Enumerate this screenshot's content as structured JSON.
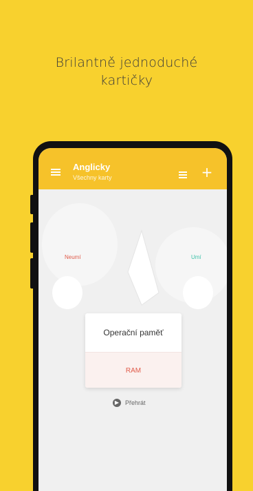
{
  "headline": {
    "line1": "Brilantně jednoduché",
    "line2": "kartičky"
  },
  "app": {
    "title": "Anglicky",
    "subtitle": "Všechny karty"
  },
  "hints": {
    "left": "Neumí",
    "right": "Umí"
  },
  "card": {
    "front": "Operační paměť",
    "back": "RAM"
  },
  "skip": {
    "label": "Přehrát"
  },
  "colors": {
    "background": "#F8D12E",
    "appbar": "#F6C22A",
    "negative": "#e05b4a",
    "positive": "#3ec2a9"
  },
  "icons": [
    "menu-icon",
    "grid-icon",
    "add-icon",
    "play-icon"
  ]
}
